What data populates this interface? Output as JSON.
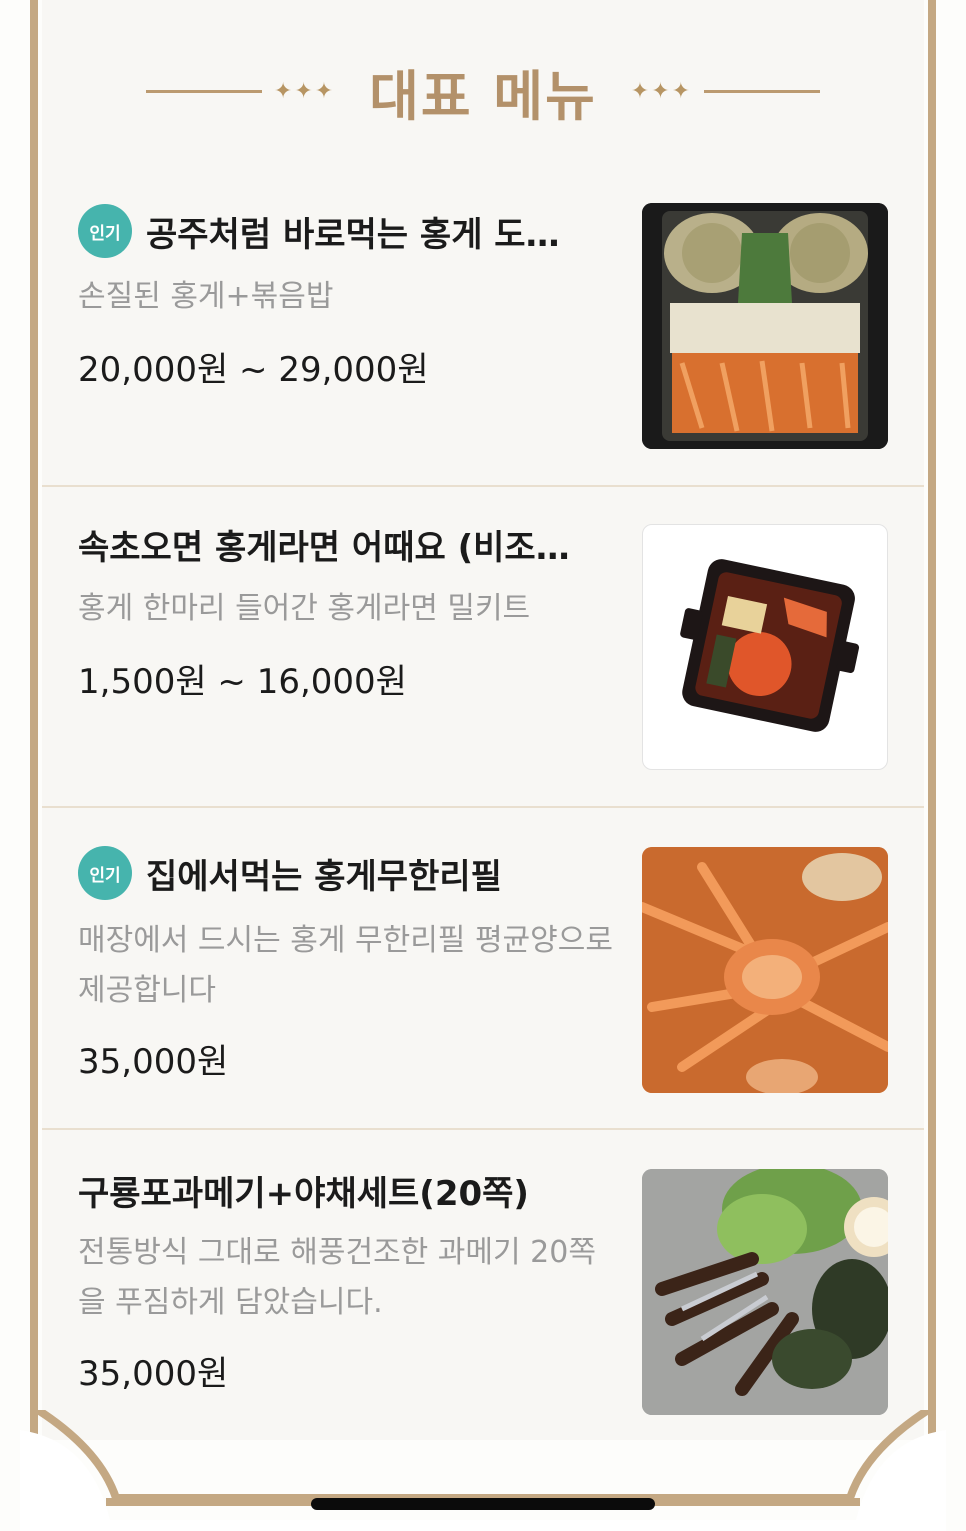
{
  "header": {
    "title": "대표 메뉴",
    "ornament_left": "✦✦✦",
    "ornament_right": "✦✦✦"
  },
  "menu_items": [
    {
      "badge": "인기",
      "name": "공주처럼 바로먹는 홍게 도…",
      "description": "손질된 홍게+볶음밥",
      "price": "20,000원 ~ 29,000원",
      "image_icon": "crab-rice-box-photo"
    },
    {
      "badge": "",
      "name": "속초오면 홍게라면 어때요 (비조…",
      "description": "홍게 한마리 들어간 홍게라면 밀키트",
      "price": "1,500원 ~ 16,000원",
      "image_icon": "crab-ramen-kit-photo"
    },
    {
      "badge": "인기",
      "name": "집에서먹는 홍게무한리필",
      "description": "매장에서 드시는 홍게 무한리필 평균양으로 제공합니다",
      "price": "35,000원",
      "image_icon": "steamed-crab-photo"
    },
    {
      "badge": "",
      "name": "구룡포과메기+야채세트(20쪽)",
      "description": "전통방식 그대로 해풍건조한 과메기 20쪽을 푸짐하게 담았습니다.",
      "price": "35,000원",
      "image_icon": "gwamegi-set-photo"
    }
  ],
  "colors": {
    "gold": "#c4a883",
    "badge": "#46b4ad",
    "title": "#b3916a"
  }
}
